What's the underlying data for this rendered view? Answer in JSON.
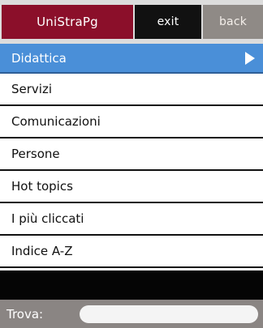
{
  "header": {
    "brand_label": "UniStraPg",
    "exit_label": "exit",
    "back_label": "back"
  },
  "menu": {
    "items": [
      {
        "label": "Didattica",
        "active": true
      },
      {
        "label": "Servizi"
      },
      {
        "label": "Comunicazioni"
      },
      {
        "label": "Persone"
      },
      {
        "label": "Hot topics"
      },
      {
        "label": "I più cliccati"
      },
      {
        "label": "Indice A-Z"
      }
    ]
  },
  "search": {
    "label": "Trova:",
    "value": ""
  },
  "colors": {
    "brand": "#8b0f2a",
    "active_item": "#4a8fd8"
  }
}
